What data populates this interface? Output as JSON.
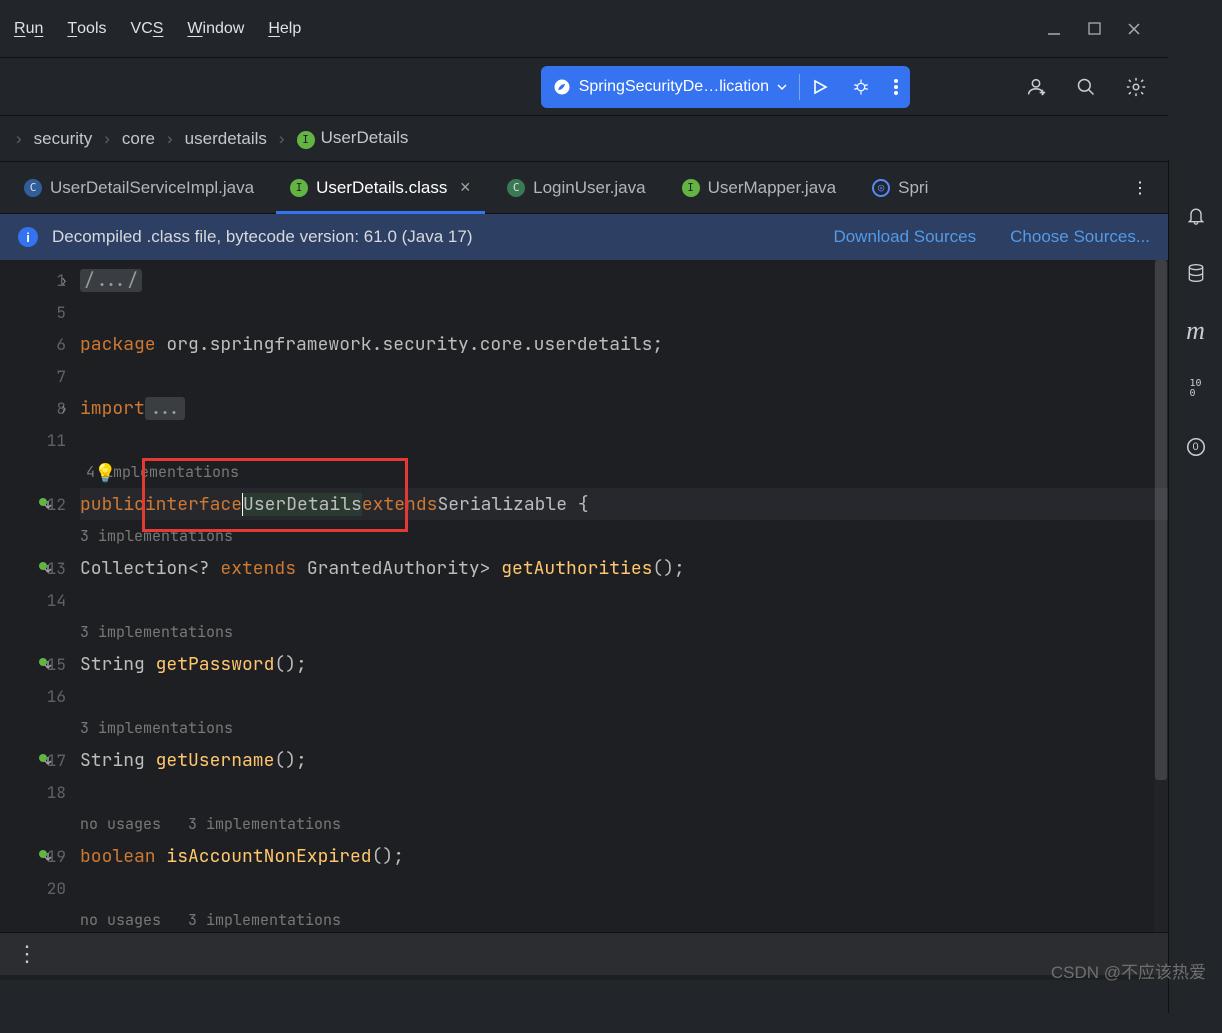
{
  "menu": {
    "run": "Run",
    "tools": "Tools",
    "vcs": "VCS",
    "window": "Window",
    "help": "Help"
  },
  "runconfig": {
    "label": "SpringSecurityDe…lication"
  },
  "breadcrumb": {
    "items": [
      "security",
      "core",
      "userdetails"
    ],
    "leaf": "UserDetails"
  },
  "tabs": [
    {
      "icon": "c",
      "label": "UserDetailServiceImpl.java"
    },
    {
      "icon": "i",
      "label": "UserDetails.class",
      "active": true,
      "closable": true
    },
    {
      "icon": "cj",
      "label": "LoginUser.java"
    },
    {
      "icon": "i",
      "label": "UserMapper.java"
    },
    {
      "icon": "k",
      "label": "Spri"
    }
  ],
  "notif": {
    "msg": "Decompiled .class file, bytecode version: 61.0 (Java 17)",
    "link1": "Download Sources",
    "link2": "Choose Sources..."
  },
  "code": {
    "lines": [
      "1",
      "5",
      "6",
      "7",
      "8",
      "11",
      "",
      "12",
      "",
      "13",
      "14",
      "",
      "15",
      "16",
      "",
      "17",
      "18",
      "",
      "19",
      "20",
      ""
    ],
    "folded": "/.../",
    "pkg_kw": "package",
    "pkg_name": " org.springframework.security.core.userdetails;",
    "imp_kw": "import",
    "imp_dots": "...",
    "hint4": "4 implementations",
    "l12": {
      "public": "public",
      "interface": "interface",
      "name": "UserDetails",
      "extends": "extends",
      "ser": "Serializable",
      "brace": " {"
    },
    "hint3": "3 implementations",
    "l13": {
      "coll": "Collection<? ",
      "ext": "extends",
      "ga": " GrantedAuthority> ",
      "fn": "getAuthorities",
      "paren": "();"
    },
    "l15": {
      "type": "String ",
      "fn": "getPassword",
      "paren": "();"
    },
    "l17": {
      "type": "String ",
      "fn": "getUsername",
      "paren": "();"
    },
    "nousage": "no usages   3 implementations",
    "l19": {
      "type": "boolean ",
      "fn": "isAccountNonExpired",
      "paren": "();"
    }
  },
  "rail": {
    "coverage": "10\n0"
  },
  "watermark": "CSDN @不应该热爱"
}
